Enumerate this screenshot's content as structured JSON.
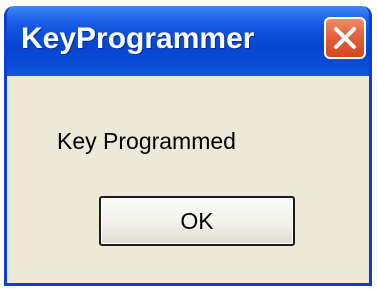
{
  "window": {
    "title": "KeyProgrammer",
    "close_icon": "close-icon"
  },
  "dialog": {
    "message": "Key Programmed",
    "ok_label": "OK"
  },
  "colors": {
    "titlebar": "#0646d0",
    "frame": "#0a3fd8",
    "body": "#ece9d8",
    "close_button": "#d4461f"
  }
}
